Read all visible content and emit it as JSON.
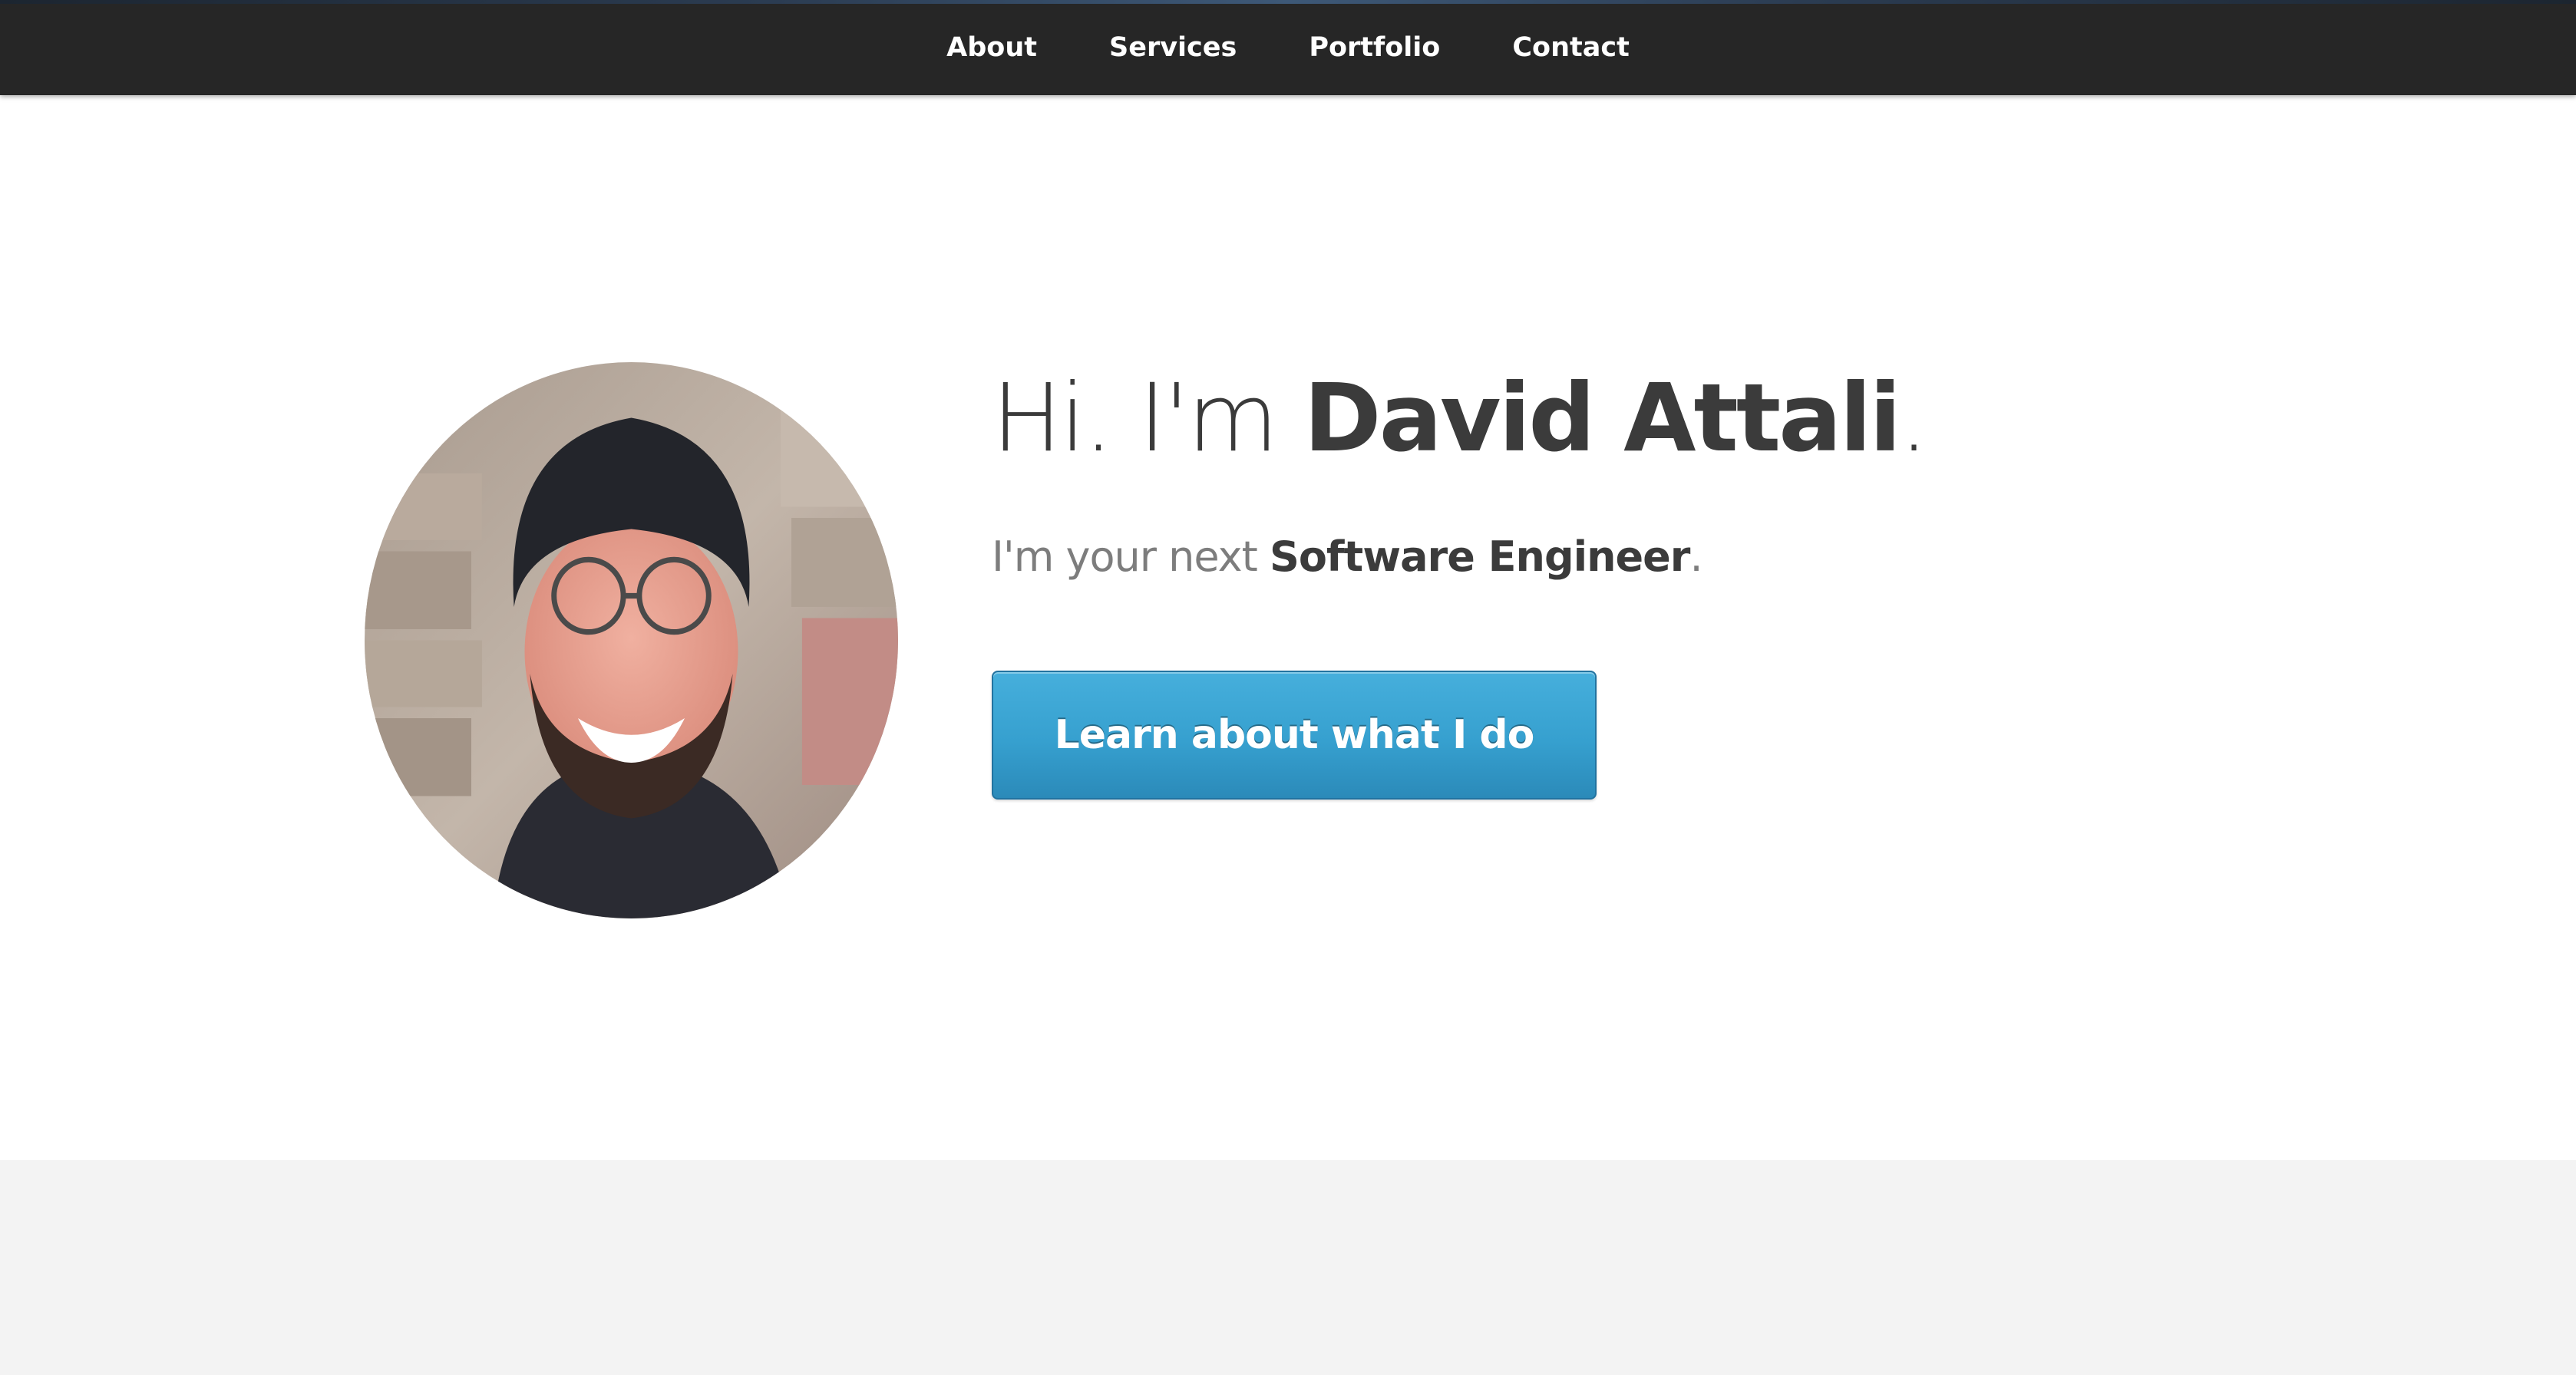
{
  "nav": {
    "items": [
      {
        "label": "About"
      },
      {
        "label": "Services"
      },
      {
        "label": "Portfolio"
      },
      {
        "label": "Contact"
      }
    ]
  },
  "hero": {
    "greeting": "Hi. I'm",
    "name": "David Attali",
    "greeting_end": ".",
    "tagline_prefix": "I'm your next",
    "tagline_role": "Software Engineer",
    "tagline_end": ".",
    "cta_label": "Learn about what I do"
  },
  "colors": {
    "navbar": "#262626",
    "button": "#36a0cf",
    "heading_text": "#3b3b3b",
    "muted_text": "#7d7d7d"
  }
}
